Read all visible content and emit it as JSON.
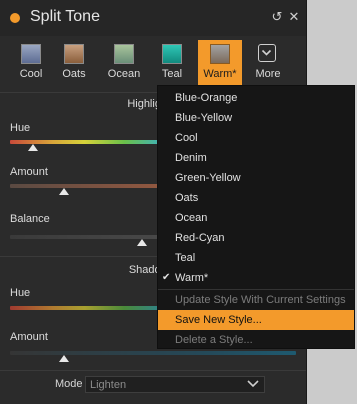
{
  "window": {
    "title": "Split Tone",
    "accent": "#f39a2b"
  },
  "styles": [
    {
      "label": "Cool",
      "colors": [
        "#9aa7c2",
        "#5d6c93"
      ],
      "active": false
    },
    {
      "label": "Oats",
      "colors": [
        "#c8a080",
        "#8a5e3b"
      ],
      "active": false
    },
    {
      "label": "Ocean",
      "colors": [
        "#a9c49c",
        "#6a8e78"
      ],
      "active": false
    },
    {
      "label": "Teal",
      "colors": [
        "#2fc7b6",
        "#118a7e"
      ],
      "active": false
    },
    {
      "label": "Warm*",
      "colors": [
        "#a3a3a3",
        "#7b6a5b"
      ],
      "active": true
    }
  ],
  "more_label": "More",
  "highlights": {
    "heading": "Highlights:",
    "hue_label": "Hue",
    "amount_label": "Amount",
    "balance_label": "Balance",
    "hue_level": 0.08,
    "amount_level": 0.19,
    "balance_level": 0.46
  },
  "shadows": {
    "heading": "Shadows:",
    "hue_label": "Hue",
    "amount_label": "Amount",
    "amount_level": 0.19
  },
  "mode": {
    "label": "Mode",
    "value": "Lighten"
  },
  "menu": {
    "items": [
      {
        "label": "Blue-Orange"
      },
      {
        "label": "Blue-Yellow"
      },
      {
        "label": "Cool"
      },
      {
        "label": "Denim"
      },
      {
        "label": "Green-Yellow"
      },
      {
        "label": "Oats"
      },
      {
        "label": "Ocean"
      },
      {
        "label": "Red-Cyan"
      },
      {
        "label": "Teal"
      },
      {
        "label": "Warm*"
      }
    ],
    "checked": "Warm*",
    "actions": [
      {
        "label": "Update Style With Current Settings",
        "state": "disabled"
      },
      {
        "label": "Save New Style...",
        "state": "highlighted"
      },
      {
        "label": "Delete a Style...",
        "state": "disabled"
      }
    ]
  }
}
